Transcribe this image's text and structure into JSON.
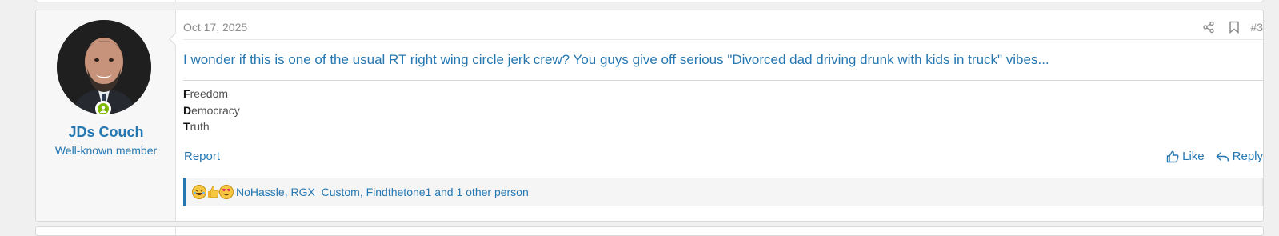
{
  "post": {
    "date": "Oct 17, 2025",
    "number": "#3",
    "message": "I wonder if this is one of the usual RT right wing circle jerk crew? You guys give off serious \"Divorced dad driving drunk with kids in truck\" vibes...",
    "signature": [
      {
        "initial": "F",
        "rest": "reedom"
      },
      {
        "initial": "D",
        "rest": "emocracy"
      },
      {
        "initial": "T",
        "rest": "ruth"
      }
    ],
    "report_label": "Report",
    "like_label": "Like",
    "reply_label": "Reply",
    "reactions_text": "NoHassle, RGX_Custom, Findthetone1 and 1 other person",
    "reaction_icons": [
      "laughing-emoji-icon",
      "thumbs-up-emoji-icon",
      "heart-eyes-emoji-icon"
    ]
  },
  "author": {
    "username": "JDs Couch",
    "title": "Well-known member",
    "online": true
  },
  "colors": {
    "link": "#2577b1",
    "muted": "#8c8c8c",
    "online": "#7fb900"
  }
}
